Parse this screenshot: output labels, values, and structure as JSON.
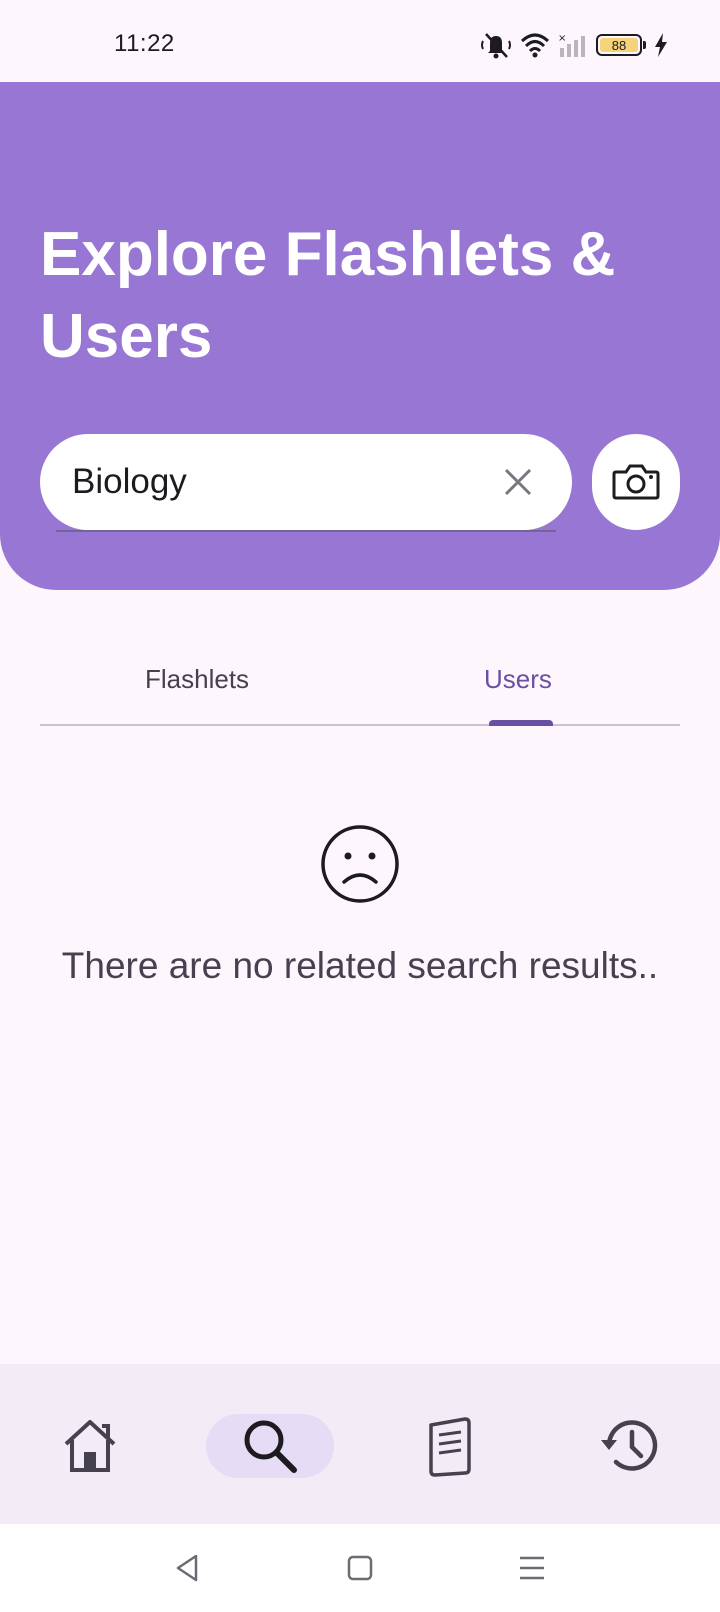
{
  "status_bar": {
    "time": "11:22",
    "battery_level": "88",
    "icons": [
      "mute-icon",
      "wifi-icon",
      "signal-icon",
      "battery-icon",
      "charging-icon"
    ]
  },
  "header": {
    "title_line1": "Explore Flashlets &",
    "title_line2": "Users",
    "background_color": "#9876d3"
  },
  "search": {
    "value": "Biology",
    "clear_icon": "close-icon",
    "camera_icon": "camera-icon"
  },
  "tabs": [
    {
      "label": "Flashlets",
      "selected": false
    },
    {
      "label": "Users",
      "selected": true
    }
  ],
  "empty_state": {
    "icon": "sad-face-icon",
    "message": "There are no related search results.."
  },
  "bottom_nav": {
    "items": [
      {
        "icon": "home-icon",
        "selected": false
      },
      {
        "icon": "search-icon",
        "selected": true
      },
      {
        "icon": "flashcards-icon",
        "selected": false
      },
      {
        "icon": "history-icon",
        "selected": false
      }
    ]
  },
  "system_nav": [
    "back-icon",
    "home-square-icon",
    "menu-icon"
  ]
}
